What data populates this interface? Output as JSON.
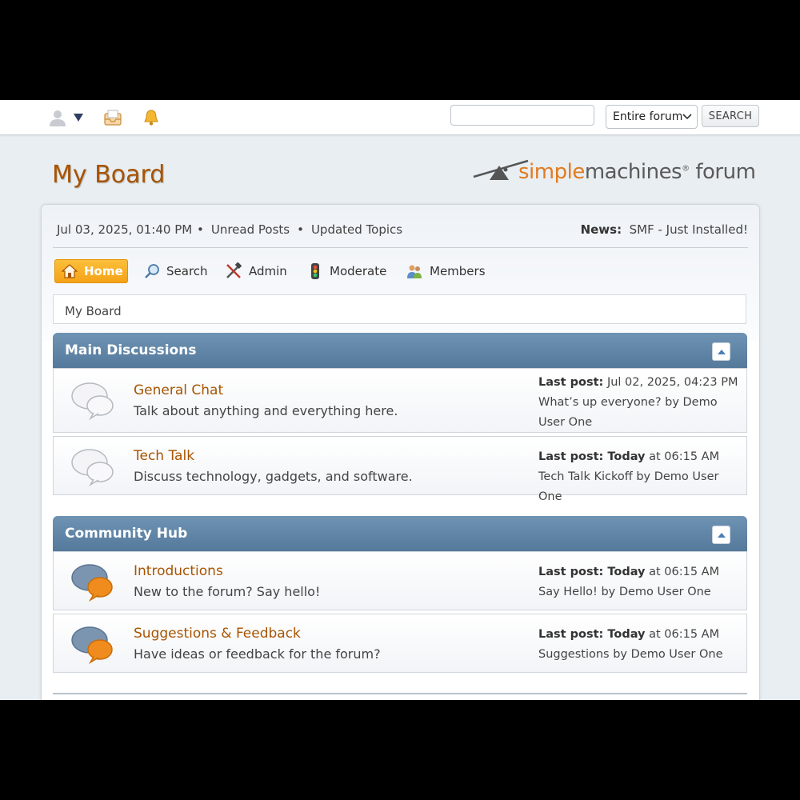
{
  "topbar": {
    "search_placeholder": "",
    "scope_selected": "Entire forum",
    "search_button": "SEARCH"
  },
  "header": {
    "forum_title": "My Board",
    "logo_part1": "simple",
    "logo_part2": "machines",
    "logo_reg": "®",
    "logo_part3": " forum"
  },
  "upper": {
    "datetime": "Jul 03, 2025, 01:40 PM",
    "bullet": "•",
    "unread_posts": "Unread Posts",
    "updated_topics": "Updated Topics",
    "news_label": "News:",
    "news_text": "SMF - Just Installed!"
  },
  "menu": {
    "home": "Home",
    "search": "Search",
    "admin": "Admin",
    "moderate": "Moderate",
    "members": "Members"
  },
  "breadcrumb": "My Board",
  "categories": [
    {
      "name": "Main Discussions",
      "boards": [
        {
          "name": "General Chat",
          "description": "Talk about anything and everything here.",
          "last_label": "Last post:",
          "last_when": " Jul 02, 2025, 04:23 PM",
          "last_topic": "What’s up everyone? by Demo User One",
          "icon": "speech-bubbles-gray-icon"
        },
        {
          "name": "Tech Talk",
          "description": "Discuss technology, gadgets, and software.",
          "last_label": "Last post:",
          "last_today": " Today",
          "last_when": " at 06:15 AM",
          "last_topic": "Tech Talk Kickoff by Demo User One",
          "icon": "speech-bubbles-gray-icon"
        }
      ]
    },
    {
      "name": "Community Hub",
      "boards": [
        {
          "name": "Introductions",
          "description": "New to the forum? Say hello!",
          "last_label": "Last post:",
          "last_today": " Today",
          "last_when": " at 06:15 AM",
          "last_topic": "Say Hello! by Demo User One",
          "icon": "speech-bubbles-new-icon"
        },
        {
          "name": "Suggestions & Feedback",
          "description": "Have ideas or feedback for the forum?",
          "last_label": "Last post:",
          "last_today": " Today",
          "last_when": " at 06:15 AM",
          "last_topic": "Suggestions by Demo User One",
          "icon": "speech-bubbles-new-icon"
        }
      ]
    }
  ],
  "colors": {
    "accent": "#a85400",
    "category_header": "#5f84a6",
    "home_button": "#f6ac22"
  }
}
